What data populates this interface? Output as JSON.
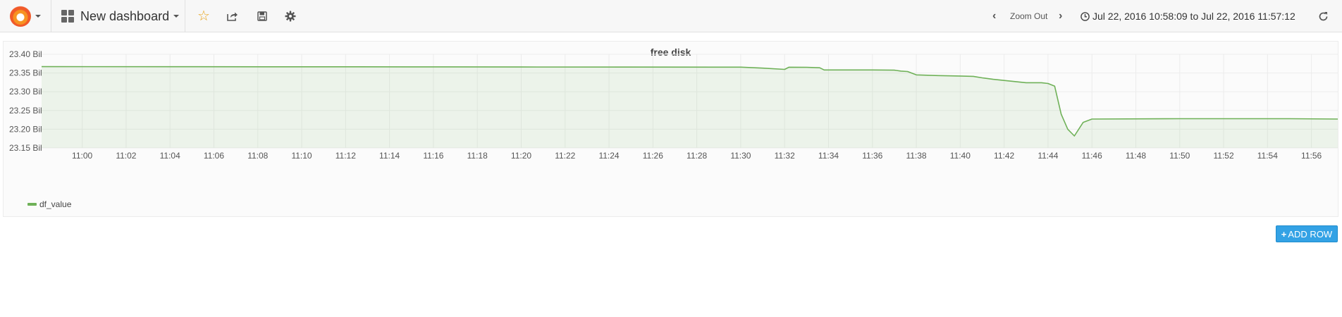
{
  "navbar": {
    "logo_icon": "grafana-logo-icon",
    "dashboard_icon": "dashboard-grid-icon",
    "dashboard_title": "New dashboard",
    "toolbar_icons": [
      "star-icon",
      "share-icon",
      "save-icon",
      "settings-gear-icon"
    ],
    "zoom_out_label": "Zoom Out",
    "time_range": "Jul 22, 2016 10:58:09 to Jul 22, 2016 11:57:12",
    "refresh_icon": "refresh-icon"
  },
  "panel": {
    "title": "free disk",
    "legend": [
      {
        "name": "df_value",
        "color": "#6fb158"
      }
    ]
  },
  "add_row_label": "ADD ROW",
  "chart_data": {
    "type": "area",
    "title": "free disk",
    "x_tick_labels": [
      "11:00",
      "11:02",
      "11:04",
      "11:06",
      "11:08",
      "11:10",
      "11:12",
      "11:14",
      "11:16",
      "11:18",
      "11:20",
      "11:22",
      "11:24",
      "11:26",
      "11:28",
      "11:30",
      "11:32",
      "11:34",
      "11:36",
      "11:38",
      "11:40",
      "11:42",
      "11:44",
      "11:46",
      "11:48",
      "11:50",
      "11:52",
      "11:54",
      "11:56"
    ],
    "y_tick_labels": [
      "23.15 Bil",
      "23.20 Bil",
      "23.25 Bil",
      "23.30 Bil",
      "23.35 Bil",
      "23.40 Bil"
    ],
    "ylim": [
      23.15,
      23.4
    ],
    "xlim_minutes": [
      -1.85,
      57.2
    ],
    "grid": true,
    "series": [
      {
        "name": "df_value",
        "color": "#6fb158",
        "x_minutes": [
          -1.85,
          5,
          10,
          15,
          20,
          25,
          30,
          31,
          32,
          32.2,
          33,
          33.6,
          33.8,
          35,
          36,
          37,
          37.3,
          37.6,
          38,
          39,
          40,
          40.6,
          41,
          41.5,
          42,
          43,
          43.7,
          44,
          44.3,
          44.6,
          44.9,
          45.2,
          45.6,
          46,
          50,
          55,
          57.2
        ],
        "y_values": [
          23.367,
          23.3668,
          23.3665,
          23.3663,
          23.366,
          23.3658,
          23.3656,
          23.363,
          23.3595,
          23.3655,
          23.365,
          23.364,
          23.358,
          23.358,
          23.358,
          23.3575,
          23.355,
          23.354,
          23.345,
          23.343,
          23.342,
          23.341,
          23.337,
          23.333,
          23.33,
          23.324,
          23.324,
          23.322,
          23.315,
          23.24,
          23.2,
          23.182,
          23.218,
          23.227,
          23.228,
          23.228,
          23.227
        ]
      }
    ]
  }
}
